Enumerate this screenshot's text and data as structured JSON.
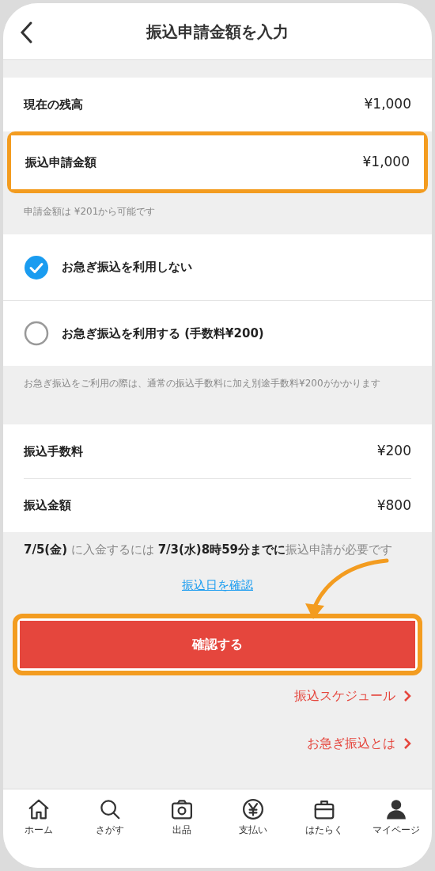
{
  "header": {
    "title": "振込申請金額を入力"
  },
  "balance_rows": [
    {
      "label": "現在の残高",
      "value": "¥1,000",
      "highlighted": false
    },
    {
      "label": "振込申請金額",
      "value": "¥1,000",
      "highlighted": true
    }
  ],
  "amount_hint": "申請金額は ¥201から可能です",
  "options": [
    {
      "label": "お急ぎ振込を利用しない",
      "selected": true
    },
    {
      "label": "お急ぎ振込を利用する (手数料¥200)",
      "selected": false
    }
  ],
  "express_note": "お急ぎ振込をご利用の際は、通常の振込手数料に加え別途手数料¥200がかかります",
  "fee_rows": [
    {
      "label": "振込手数料",
      "value": "¥200"
    },
    {
      "label": "振込金額",
      "value": "¥800"
    }
  ],
  "deadline": "**7/5(金)** に入金するには **7/3(水)8時59分までに**振込申請が必要です",
  "date_link": "振込日を確認",
  "confirm_button": {
    "label": "確認する",
    "highlighted": true
  },
  "links": [
    "振込スケジュール",
    "お急ぎ振込とは"
  ],
  "tabs": [
    {
      "label": "ホーム",
      "kind": "home"
    },
    {
      "label": "さがす",
      "kind": "search"
    },
    {
      "label": "出品",
      "kind": "camera"
    },
    {
      "label": "支払い",
      "kind": "yen"
    },
    {
      "label": "はたらく",
      "kind": "briefcase"
    },
    {
      "label": "マイページ",
      "kind": "person"
    }
  ]
}
